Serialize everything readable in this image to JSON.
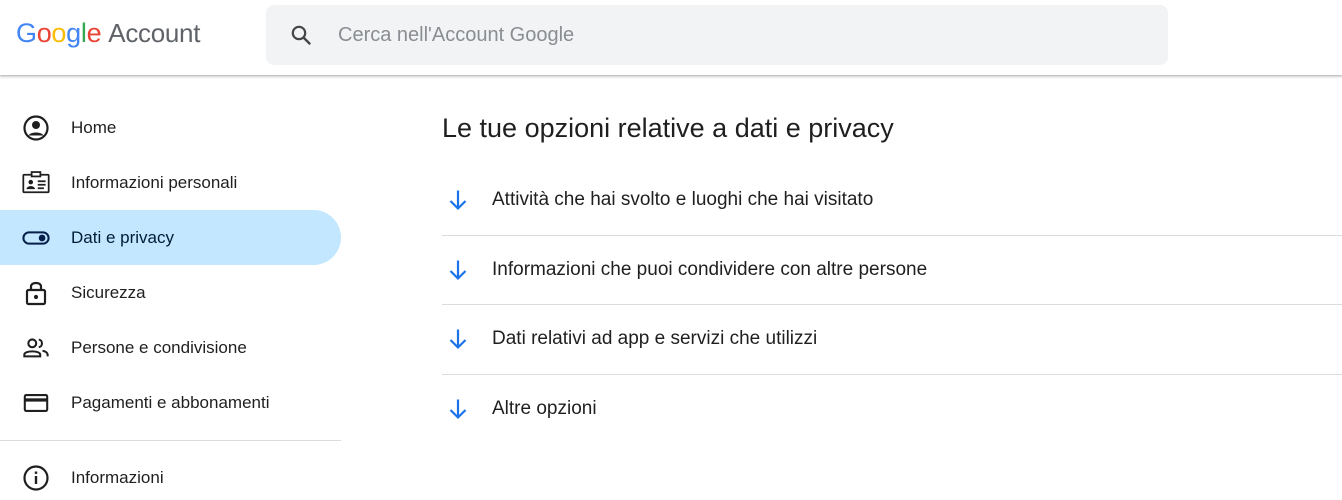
{
  "header": {
    "logo": {
      "letters": [
        "G",
        "o",
        "o",
        "g",
        "l",
        "e"
      ],
      "account": "Account"
    },
    "search": {
      "placeholder": "Cerca nell'Account Google",
      "value": ""
    }
  },
  "sidebar": {
    "items": [
      {
        "label": "Home",
        "icon": "account-circle-icon",
        "active": false
      },
      {
        "label": "Informazioni personali",
        "icon": "id-card-icon",
        "active": false
      },
      {
        "label": "Dati e privacy",
        "icon": "toggle-icon",
        "active": true
      },
      {
        "label": "Sicurezza",
        "icon": "lock-icon",
        "active": false
      },
      {
        "label": "Persone e condivisione",
        "icon": "people-icon",
        "active": false
      },
      {
        "label": "Pagamenti e abbonamenti",
        "icon": "credit-card-icon",
        "active": false
      }
    ],
    "footer_items": [
      {
        "label": "Informazioni",
        "icon": "info-icon"
      }
    ]
  },
  "main": {
    "title": "Le tue opzioni relative a dati e privacy",
    "options": [
      {
        "label": "Attività che hai svolto e luoghi che hai visitato",
        "icon": "arrow-down-icon"
      },
      {
        "label": "Informazioni che puoi condividere con altre persone",
        "icon": "arrow-down-icon"
      },
      {
        "label": "Dati relativi ad app e servizi che utilizzi",
        "icon": "arrow-down-icon"
      },
      {
        "label": "Altre opzioni",
        "icon": "arrow-down-icon"
      }
    ]
  },
  "colors": {
    "active_nav_bg": "#c2e7ff",
    "arrow_blue": "#1a73e8",
    "search_bg": "#f1f3f4",
    "divider": "#dadce0"
  }
}
